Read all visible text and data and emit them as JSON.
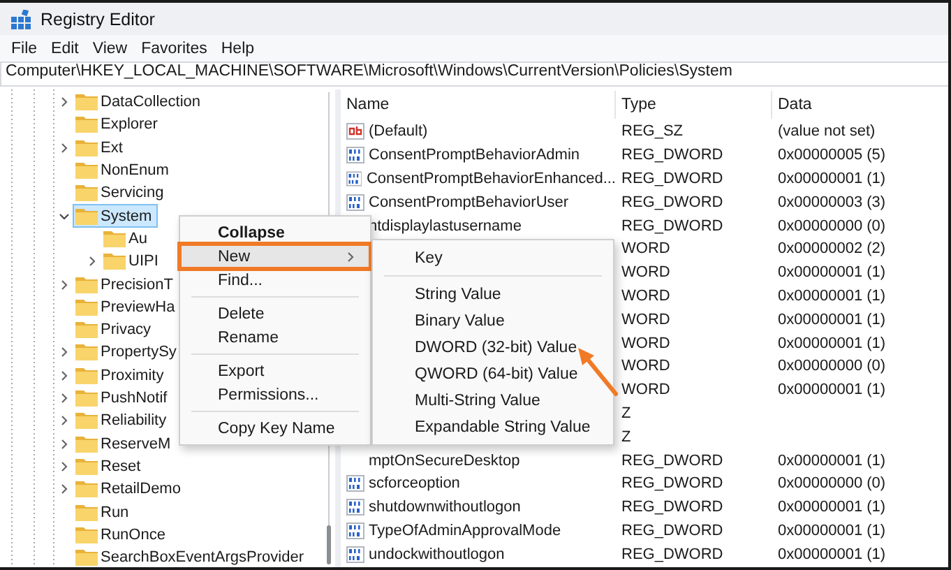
{
  "window": {
    "title": "Registry Editor"
  },
  "menu_bar": [
    "File",
    "Edit",
    "View",
    "Favorites",
    "Help"
  ],
  "address_bar": {
    "value": "Computer\\HKEY_LOCAL_MACHINE\\SOFTWARE\\Microsoft\\Windows\\CurrentVersion\\Policies\\System"
  },
  "tree": {
    "items": [
      {
        "kind": "branch",
        "label": "DataCollection",
        "expanded": false,
        "selected": false
      },
      {
        "kind": "leaf",
        "label": "Explorer",
        "selected": false
      },
      {
        "kind": "branch",
        "label": "Ext",
        "expanded": false,
        "selected": false
      },
      {
        "kind": "leaf",
        "label": "NonEnum",
        "selected": false
      },
      {
        "kind": "leaf",
        "label": "Servicing",
        "selected": false
      },
      {
        "kind": "branch",
        "label": "System",
        "expanded": true,
        "selected": true,
        "children": [
          {
            "kind": "leaf",
            "label": "Au",
            "selected": false
          },
          {
            "kind": "branch",
            "label": "UIPI",
            "expanded": false,
            "selected": false
          }
        ]
      },
      {
        "kind": "branch",
        "label": "PrecisionT",
        "expanded": false,
        "selected": false
      },
      {
        "kind": "leaf",
        "label": "PreviewHa",
        "selected": false
      },
      {
        "kind": "leaf",
        "label": "Privacy",
        "selected": false
      },
      {
        "kind": "branch",
        "label": "PropertySy",
        "expanded": false,
        "selected": false
      },
      {
        "kind": "branch",
        "label": "Proximity",
        "expanded": false,
        "selected": false
      },
      {
        "kind": "branch",
        "label": "PushNotif",
        "expanded": false,
        "selected": false
      },
      {
        "kind": "branch",
        "label": "Reliability",
        "expanded": false,
        "selected": false
      },
      {
        "kind": "branch",
        "label": "ReserveM",
        "expanded": false,
        "selected": false
      },
      {
        "kind": "branch",
        "label": "Reset",
        "expanded": false,
        "selected": false
      },
      {
        "kind": "branch",
        "label": "RetailDemo",
        "expanded": false,
        "selected": false
      },
      {
        "kind": "leaf",
        "label": "Run",
        "selected": false
      },
      {
        "kind": "leaf",
        "label": "RunOnce",
        "selected": false
      },
      {
        "kind": "leaf",
        "label": "SearchBoxEventArgsProvider",
        "selected": false
      }
    ]
  },
  "list": {
    "columns": [
      "Name",
      "Type",
      "Data"
    ],
    "rows": [
      {
        "kind": "string",
        "name": "(Default)",
        "type": "REG_SZ",
        "data": "(value not set)"
      },
      {
        "kind": "dword",
        "name": "ConsentPromptBehaviorAdmin",
        "type": "REG_DWORD",
        "data": "0x00000005 (5)"
      },
      {
        "kind": "dword",
        "name": "ConsentPromptBehaviorEnhanced...",
        "type": "REG_DWORD",
        "data": "0x00000001 (1)"
      },
      {
        "kind": "dword",
        "name": "ConsentPromptBehaviorUser",
        "type": "REG_DWORD",
        "data": "0x00000003 (3)"
      },
      {
        "kind": "covered",
        "name": "ntdisplaylastusername",
        "type": "REG_DWORD",
        "data": "0x00000000 (0)"
      },
      {
        "kind": "covered",
        "type": "WORD",
        "data": "0x00000002 (2)"
      },
      {
        "kind": "covered",
        "type": "WORD",
        "data": "0x00000001 (1)"
      },
      {
        "kind": "covered",
        "type": "WORD",
        "data": "0x00000001 (1)"
      },
      {
        "kind": "covered",
        "type": "WORD",
        "data": "0x00000001 (1)"
      },
      {
        "kind": "covered",
        "type": "WORD",
        "data": "0x00000001 (1)"
      },
      {
        "kind": "covered",
        "type": "WORD",
        "data": "0x00000000 (0)"
      },
      {
        "kind": "covered",
        "type": "WORD",
        "data": "0x00000001 (1)"
      },
      {
        "kind": "covered",
        "type": "Z"
      },
      {
        "kind": "covered",
        "type": "Z"
      },
      {
        "kind": "covered",
        "name": "mptOnSecureDesktop",
        "type": "REG_DWORD",
        "data": "0x00000001 (1)"
      },
      {
        "kind": "dword",
        "name": "scforceoption",
        "type": "REG_DWORD",
        "data": "0x00000000 (0)"
      },
      {
        "kind": "dword",
        "name": "shutdownwithoutlogon",
        "type": "REG_DWORD",
        "data": "0x00000001 (1)"
      },
      {
        "kind": "dword",
        "name": "TypeOfAdminApprovalMode",
        "type": "REG_DWORD",
        "data": "0x00000001 (1)"
      },
      {
        "kind": "dword",
        "name": "undockwithoutlogon",
        "type": "REG_DWORD",
        "data": "0x00000001 (1)"
      }
    ]
  },
  "context_menu": {
    "items": [
      {
        "kind": "item",
        "label": "Collapse",
        "default": true,
        "highlighted": false
      },
      {
        "kind": "submenu",
        "label": "New",
        "default": false,
        "highlighted": true,
        "annotated": true
      },
      {
        "kind": "item",
        "label": "Find...",
        "default": false,
        "highlighted": false
      },
      {
        "kind": "separator"
      },
      {
        "kind": "item",
        "label": "Delete",
        "default": false,
        "highlighted": false
      },
      {
        "kind": "item",
        "label": "Rename",
        "default": false,
        "highlighted": false
      },
      {
        "kind": "separator"
      },
      {
        "kind": "item",
        "label": "Export",
        "default": false,
        "highlighted": false
      },
      {
        "kind": "item",
        "label": "Permissions...",
        "default": false,
        "highlighted": false
      },
      {
        "kind": "separator"
      },
      {
        "kind": "item",
        "label": "Copy Key Name",
        "default": false,
        "highlighted": false
      }
    ]
  },
  "submenu": {
    "items": [
      {
        "kind": "item",
        "label": "Key"
      },
      {
        "kind": "separator"
      },
      {
        "kind": "item",
        "label": "String Value"
      },
      {
        "kind": "item",
        "label": "Binary Value"
      },
      {
        "kind": "item",
        "label": "DWORD (32-bit) Value",
        "annotated": true
      },
      {
        "kind": "item",
        "label": "QWORD (64-bit) Value"
      },
      {
        "kind": "item",
        "label": "Multi-String Value"
      },
      {
        "kind": "item",
        "label": "Expandable String Value"
      }
    ]
  }
}
